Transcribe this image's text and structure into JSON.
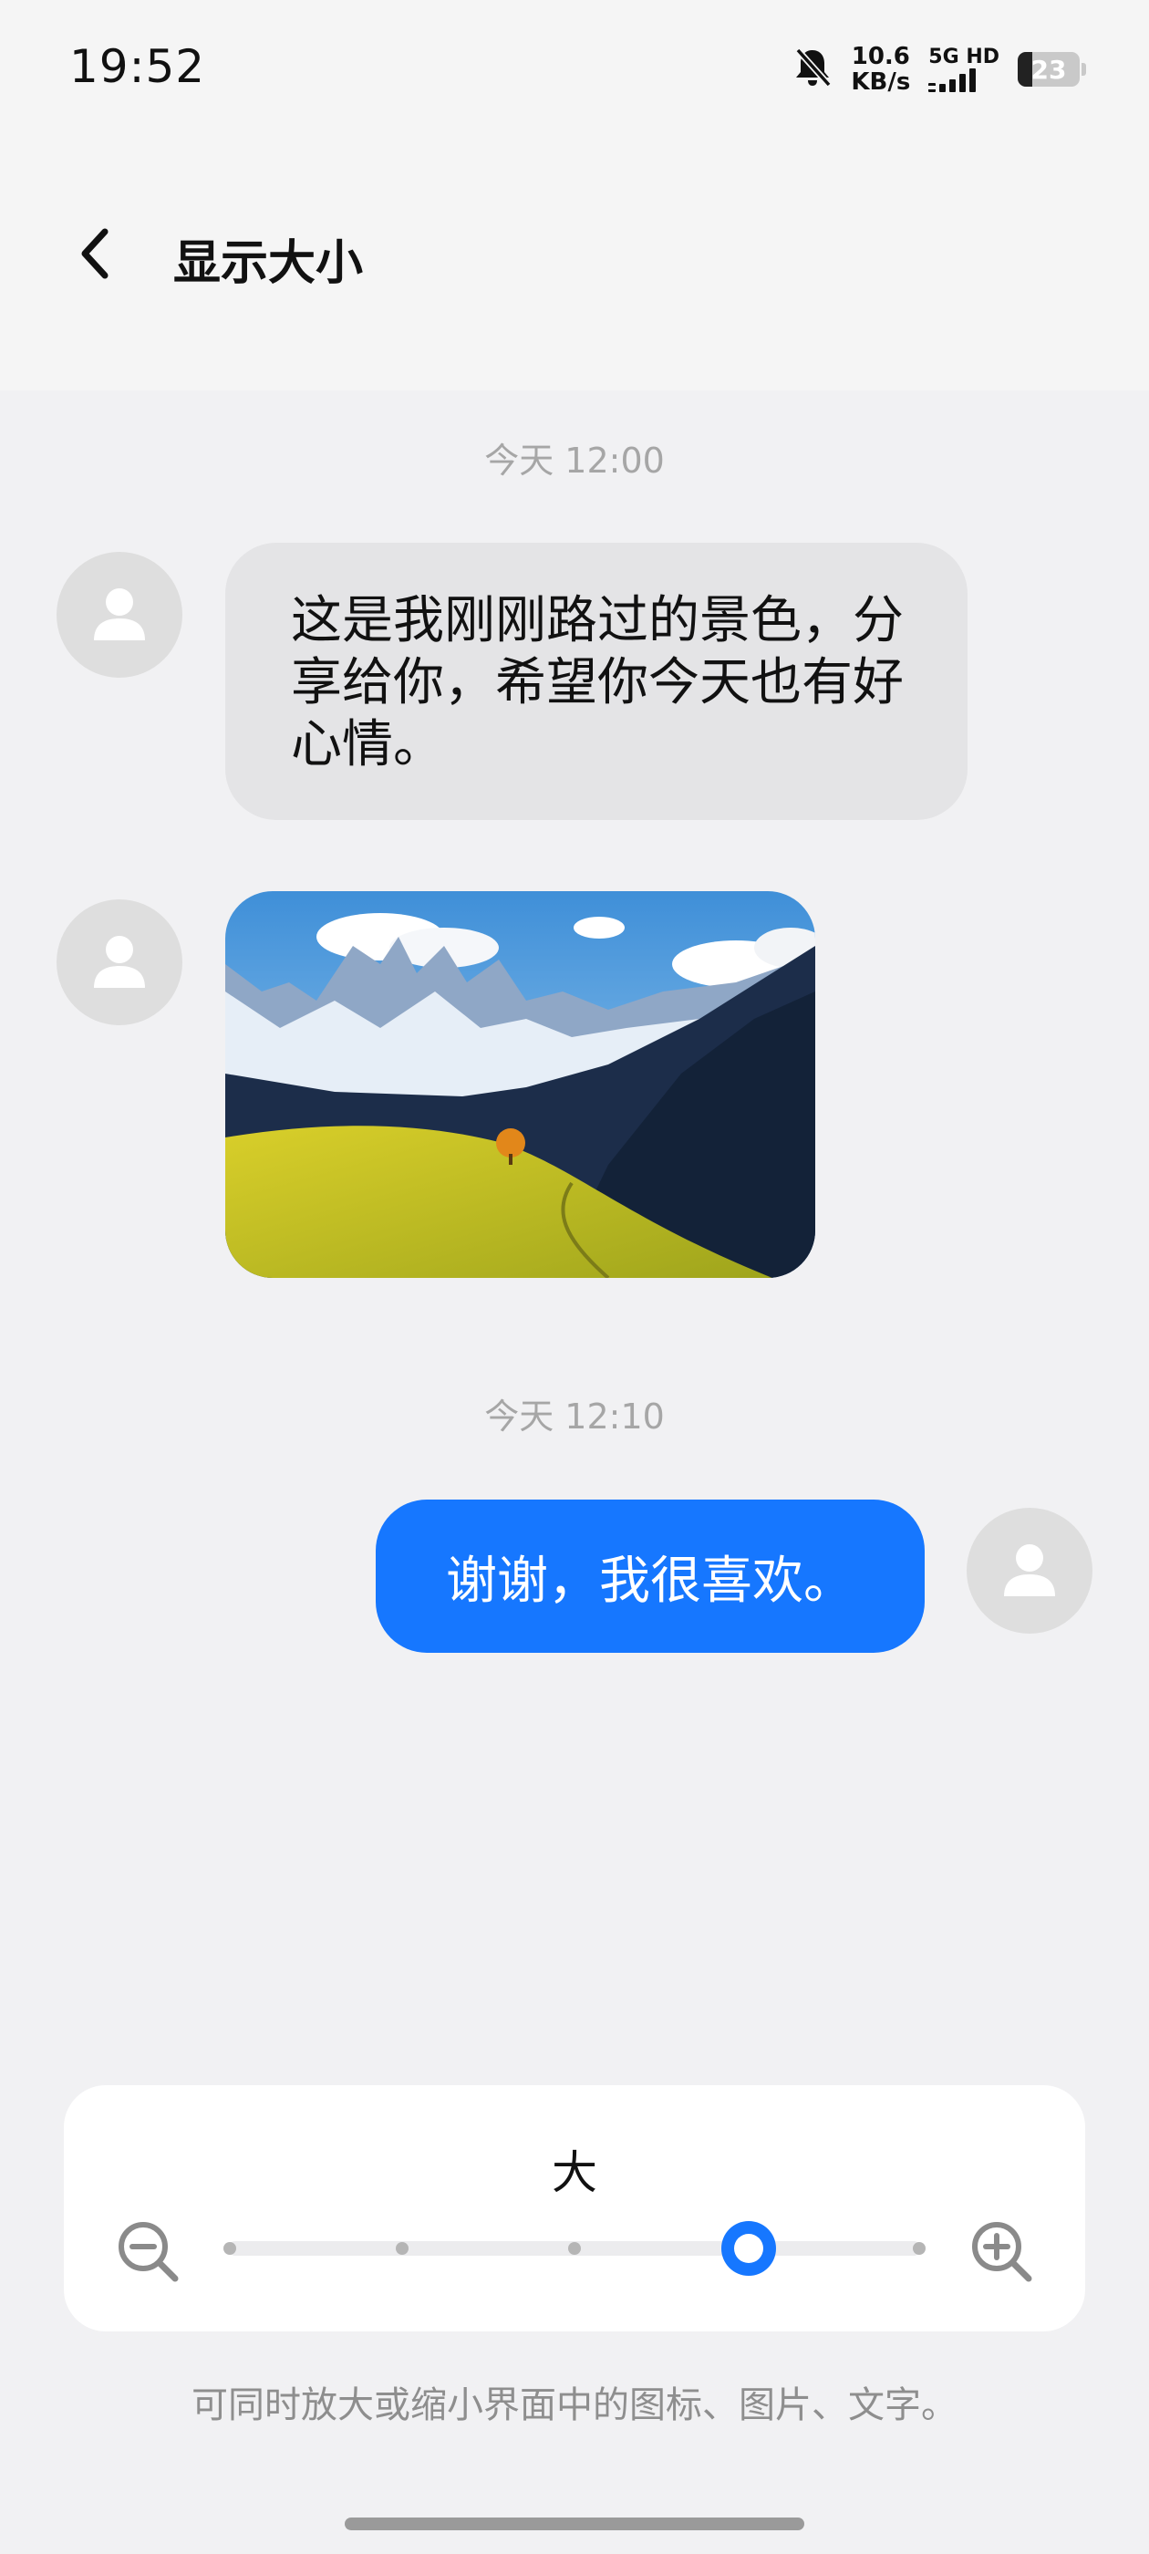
{
  "status_bar": {
    "time": "19:52",
    "net_speed_value": "10.6",
    "net_speed_unit": "KB/s",
    "network_type": "5G HD",
    "battery_level": "23",
    "icons": [
      "bell-muted-icon",
      "signal-icon",
      "battery-icon"
    ]
  },
  "header": {
    "back_icon": "chevron-left-icon",
    "title": "显示大小"
  },
  "chat": {
    "timestamp_1": "今天 12:00",
    "incoming_message": "这是我刚刚路过的景色，分享给你，希望你今天也有好心情。",
    "photo_icon": "landscape-photo",
    "timestamp_2": "今天 12:10",
    "outgoing_message": "谢谢，我很喜欢。",
    "avatar_icon": "person-icon"
  },
  "size_control": {
    "current_label": "大",
    "zoom_out_icon": "zoom-out-icon",
    "zoom_in_icon": "zoom-in-icon",
    "levels": 5,
    "selected_level": 4
  },
  "hint": "可同时放大或缩小界面中的图标、图片、文字。",
  "colors": {
    "accent": "#1677ff",
    "incoming_bubble": "#e4e4e6",
    "background": "#f1f1f3"
  }
}
